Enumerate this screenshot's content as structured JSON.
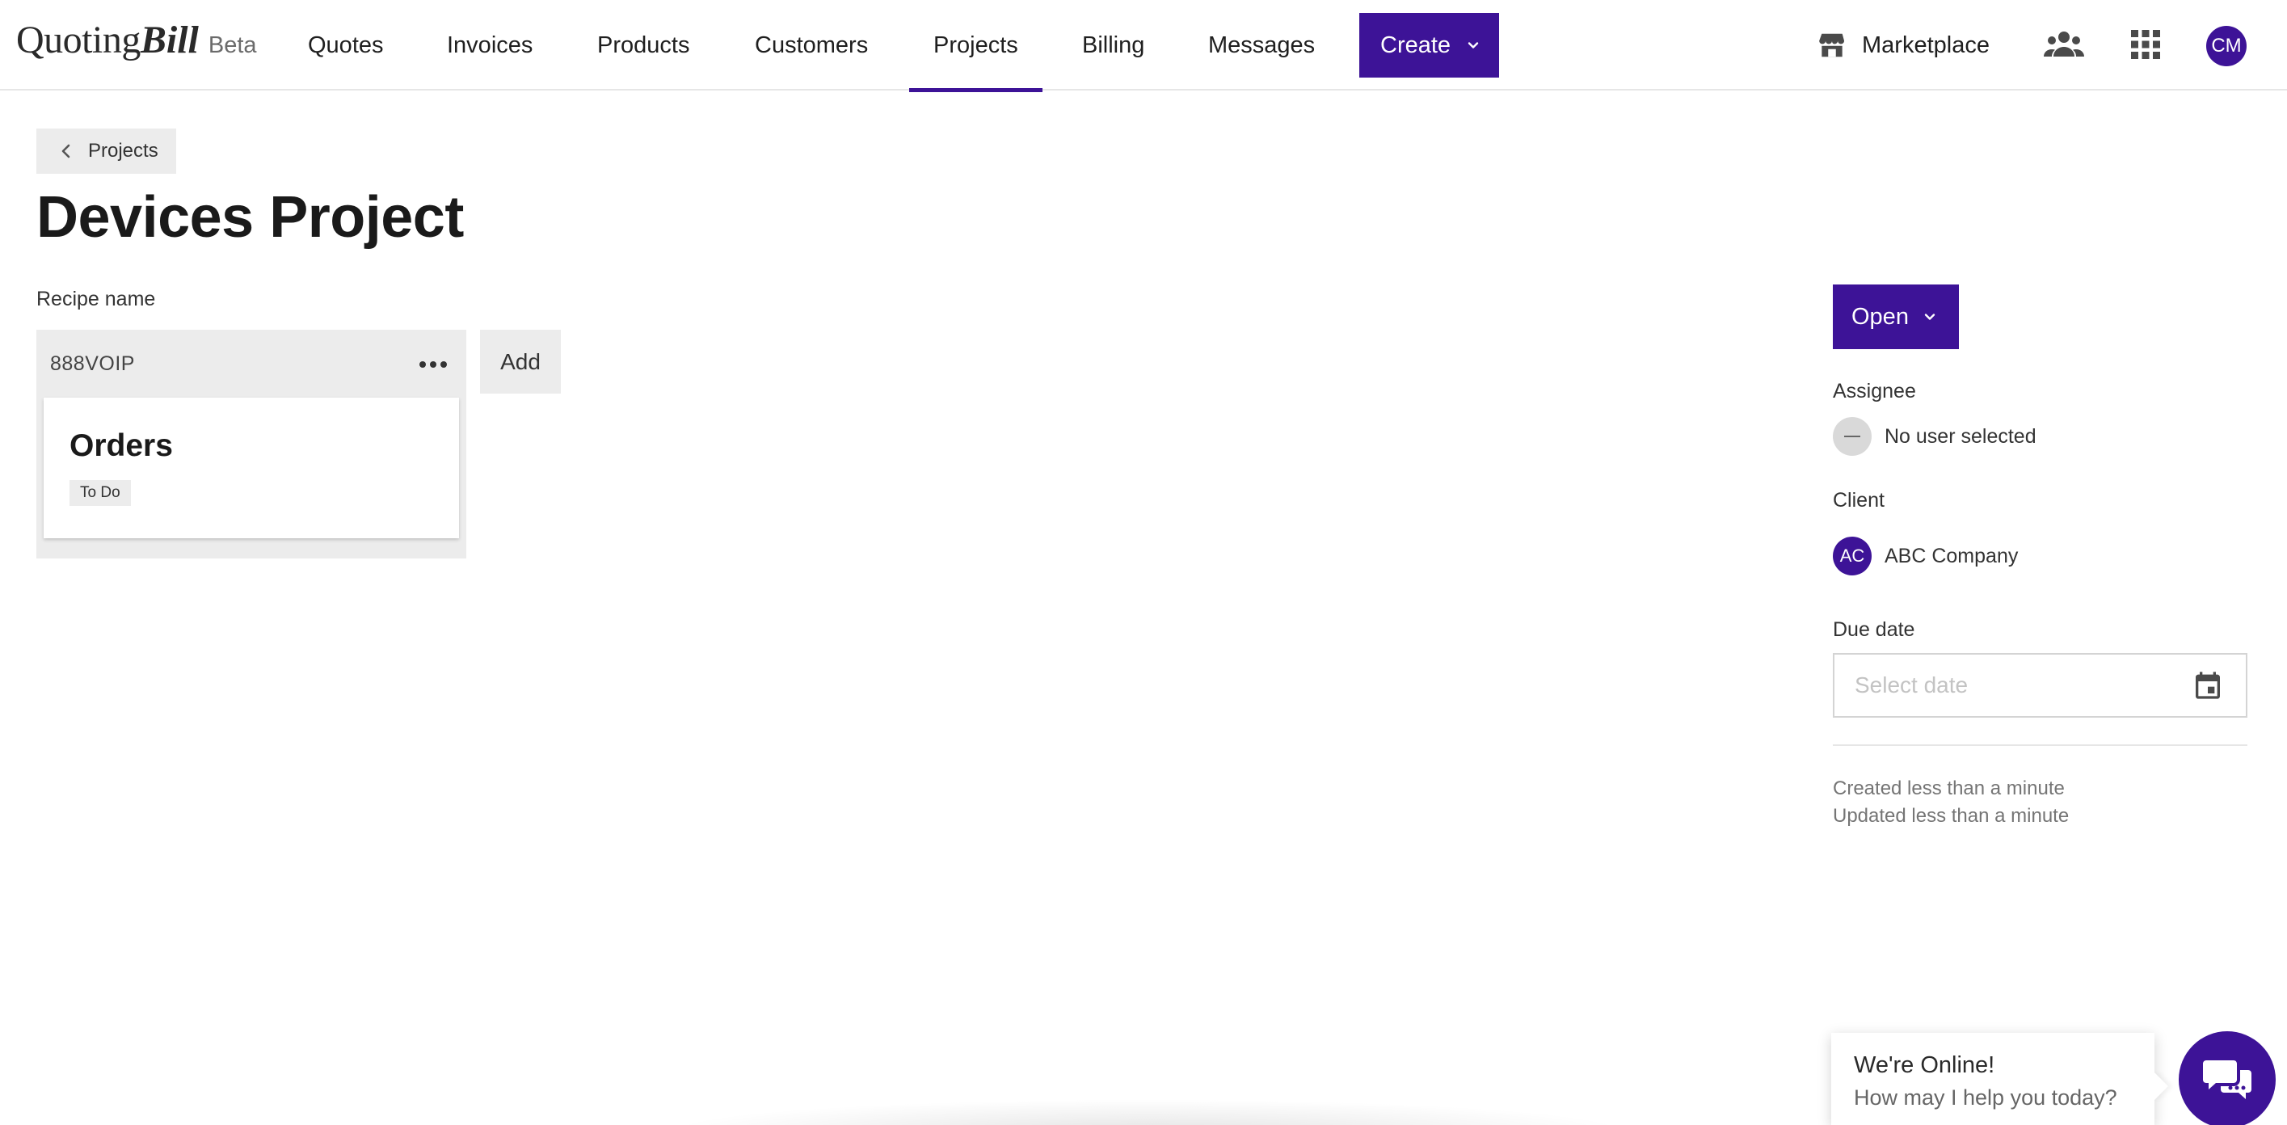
{
  "brand": {
    "name_part1": "Quoting",
    "name_part2": "Bill",
    "badge": "Beta"
  },
  "nav": {
    "items": [
      {
        "label": "Quotes"
      },
      {
        "label": "Invoices"
      },
      {
        "label": "Products"
      },
      {
        "label": "Customers"
      },
      {
        "label": "Projects",
        "active": true
      },
      {
        "label": "Billing"
      },
      {
        "label": "Messages"
      }
    ],
    "create_label": "Create",
    "marketplace_label": "Marketplace",
    "user_initials": "CM"
  },
  "breadcrumb": {
    "back_label": "Projects"
  },
  "page": {
    "title": "Devices Project"
  },
  "board": {
    "recipe_label": "Recipe name",
    "column": {
      "name": "888VOIP",
      "cards": [
        {
          "title": "Orders",
          "status": "To Do"
        }
      ]
    },
    "add_label": "Add"
  },
  "sidebar": {
    "status_button": "Open",
    "assignee_label": "Assignee",
    "assignee_value": "No user selected",
    "client_label": "Client",
    "client_initials": "AC",
    "client_value": "ABC Company",
    "due_label": "Due date",
    "due_placeholder": "Select date",
    "created": "Created less than a minute",
    "updated": "Updated less than a minute"
  },
  "chat": {
    "title": "We're Online!",
    "subtitle": "How may I help you today?"
  },
  "colors": {
    "accent": "#3d1397",
    "chip_bg": "#ececec",
    "muted_text": "#757575"
  }
}
